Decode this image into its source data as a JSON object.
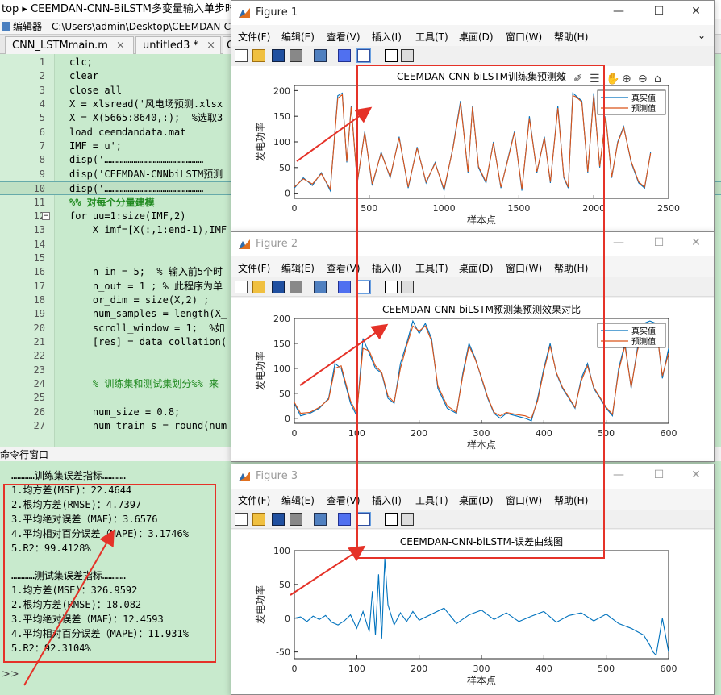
{
  "app": {
    "breadcrumb": "top ▸ CEEMDAN-CNN-BiLSTM多变量输入单步时间",
    "editor_path": "编辑器 - C:\\Users\\admin\\Desktop\\CEEMDAN-C",
    "tabs": [
      {
        "label": "CNN_LSTMmain.m"
      },
      {
        "label": "untitled3 *"
      },
      {
        "label": "C"
      }
    ]
  },
  "code_lines": [
    {
      "n": "1",
      "text": "clc;"
    },
    {
      "n": "2",
      "text": "clear"
    },
    {
      "n": "3",
      "text": "close all"
    },
    {
      "n": "4",
      "text": "X = xlsread('风电场预测.xlsx"
    },
    {
      "n": "5",
      "text": "X = X(5665:8640,:);  %选取3"
    },
    {
      "n": "6",
      "text": "load ceemdandata.mat"
    },
    {
      "n": "7",
      "text": "IMF = u';"
    },
    {
      "n": "8",
      "text": "disp('……………………………………………"
    },
    {
      "n": "9",
      "text": "disp('CEEMDAN-CNNbiLSTM预测"
    },
    {
      "n": "10",
      "text": "disp('……………………………………………"
    },
    {
      "n": "11",
      "text": "%% 对每个分量建模"
    },
    {
      "n": "12",
      "text": "for uu=1:size(IMF,2)"
    },
    {
      "n": "13",
      "text": "    X_imf=[X(:,1:end-1),IMF"
    },
    {
      "n": "14",
      "text": ""
    },
    {
      "n": "15",
      "text": ""
    },
    {
      "n": "16",
      "text": "    n_in = 5;  % 输入前5个时"
    },
    {
      "n": "17",
      "text": "    n_out = 1 ; % 此程序为单"
    },
    {
      "n": "18",
      "text": "    or_dim = size(X,2) ;"
    },
    {
      "n": "19",
      "text": "    num_samples = length(X_"
    },
    {
      "n": "20",
      "text": "    scroll_window = 1;  %如"
    },
    {
      "n": "21",
      "text": "    [res] = data_collation("
    },
    {
      "n": "22",
      "text": ""
    },
    {
      "n": "23",
      "text": ""
    },
    {
      "n": "24",
      "text": "    % 训练集和测试集划分%% 来"
    },
    {
      "n": "25",
      "text": ""
    },
    {
      "n": "26",
      "text": "    num_size = 0.8;"
    },
    {
      "n": "27",
      "text": "    num_train_s = round(num_"
    }
  ],
  "command_window": {
    "title": "命令行窗口",
    "prompt": ">>",
    "train_header": "…………训练集误差指标…………",
    "train": [
      "1.均方差(MSE)：22.4644",
      "2.根均方差(RMSE)：4.7397",
      "3.平均绝对误差（MAE）：3.6576",
      "4.平均相对百分误差（MAPE）：3.1746%",
      "5.R2：99.4128%"
    ],
    "test_header": "…………测试集误差指标…………",
    "test": [
      "1.均方差(MSE)：326.9592",
      "2.根均方差(RMSE)：18.082",
      "3.平均绝对误差（MAE）：12.4593",
      "4.平均相对百分误差（MAPE）：11.931%",
      "5.R2：92.3104%"
    ]
  },
  "figure_menu": [
    "文件(F)",
    "编辑(E)",
    "查看(V)",
    "插入(I)",
    "工具(T)",
    "桌面(D)",
    "窗口(W)",
    "帮助(H)"
  ],
  "figures": [
    {
      "title": "Figure 1",
      "chart_title": "CEEMDAN-CNN-biLSTM训练集预测效"
    },
    {
      "title": "Figure 2",
      "chart_title": "CEEMDAN-CNN-biLSTM预测集预测效果对比"
    },
    {
      "title": "Figure 3",
      "chart_title": "CEEMDAN-CNN-biLSTM-误差曲线图"
    }
  ],
  "colors": {
    "actual": "#0072BD",
    "predicted": "#D95319",
    "annotation": "#E53228"
  },
  "chart_data": [
    {
      "type": "line",
      "title": "CEEMDAN-CNN-biLSTM训练集预测效",
      "xlabel": "样本点",
      "ylabel": "发电功率",
      "xlim": [
        0,
        2500
      ],
      "ylim": [
        -10,
        210
      ],
      "xticks": [
        0,
        500,
        1000,
        1500,
        2000,
        2500
      ],
      "yticks": [
        0,
        50,
        100,
        150,
        200
      ],
      "legend": "top-right",
      "series": [
        {
          "name": "真实值",
          "x": [
            0,
            60,
            120,
            180,
            240,
            290,
            320,
            350,
            380,
            420,
            470,
            520,
            580,
            640,
            700,
            760,
            820,
            880,
            940,
            1000,
            1060,
            1110,
            1160,
            1190,
            1230,
            1280,
            1330,
            1380,
            1420,
            1470,
            1520,
            1570,
            1620,
            1670,
            1710,
            1760,
            1800,
            1830,
            1860,
            1880,
            1920,
            1960,
            2000,
            2040,
            2080,
            2120,
            2160,
            2200,
            2250,
            2300,
            2340,
            2380
          ],
          "values": [
            10,
            30,
            15,
            40,
            5,
            190,
            195,
            60,
            170,
            20,
            120,
            15,
            80,
            30,
            110,
            10,
            90,
            20,
            60,
            5,
            90,
            180,
            40,
            170,
            50,
            20,
            100,
            10,
            60,
            120,
            5,
            150,
            40,
            110,
            20,
            170,
            30,
            10,
            195,
            190,
            180,
            40,
            195,
            50,
            150,
            30,
            100,
            130,
            60,
            20,
            10,
            80
          ]
        },
        {
          "name": "预测值",
          "x": [
            0,
            60,
            120,
            180,
            240,
            290,
            320,
            350,
            380,
            420,
            470,
            520,
            580,
            640,
            700,
            760,
            820,
            880,
            940,
            1000,
            1060,
            1110,
            1160,
            1190,
            1230,
            1280,
            1330,
            1380,
            1420,
            1470,
            1520,
            1570,
            1620,
            1670,
            1710,
            1760,
            1800,
            1830,
            1860,
            1880,
            1920,
            1960,
            2000,
            2040,
            2080,
            2120,
            2160,
            2200,
            2250,
            2300,
            2340,
            2380
          ],
          "values": [
            12,
            28,
            18,
            38,
            8,
            185,
            192,
            62,
            168,
            22,
            118,
            18,
            78,
            32,
            108,
            12,
            88,
            22,
            58,
            8,
            88,
            176,
            42,
            168,
            52,
            22,
            98,
            12,
            58,
            118,
            8,
            146,
            42,
            108,
            22,
            166,
            32,
            12,
            190,
            188,
            178,
            42,
            190,
            52,
            148,
            32,
            98,
            128,
            62,
            22,
            12,
            78
          ]
        }
      ]
    },
    {
      "type": "line",
      "title": "CEEMDAN-CNN-biLSTM预测集预测效果对比",
      "xlabel": "样本点",
      "ylabel": "发电功率",
      "xlim": [
        0,
        600
      ],
      "ylim": [
        -10,
        200
      ],
      "xticks": [
        0,
        100,
        200,
        300,
        400,
        500,
        600
      ],
      "yticks": [
        0,
        50,
        100,
        150,
        200
      ],
      "legend": "top-right",
      "series": [
        {
          "name": "真实值",
          "x": [
            0,
            10,
            25,
            40,
            55,
            65,
            75,
            90,
            100,
            110,
            120,
            130,
            140,
            150,
            160,
            170,
            180,
            190,
            200,
            210,
            220,
            230,
            245,
            260,
            270,
            280,
            290,
            300,
            310,
            320,
            330,
            340,
            355,
            370,
            380,
            390,
            400,
            410,
            420,
            430,
            440,
            450,
            460,
            470,
            480,
            490,
            500,
            510,
            520,
            530,
            540,
            550,
            560,
            570,
            580,
            590,
            600
          ],
          "values": [
            30,
            5,
            10,
            20,
            40,
            110,
            100,
            30,
            5,
            160,
            130,
            100,
            90,
            40,
            30,
            110,
            150,
            195,
            170,
            190,
            160,
            60,
            20,
            10,
            90,
            150,
            120,
            80,
            40,
            10,
            0,
            10,
            5,
            0,
            -5,
            40,
            100,
            150,
            90,
            60,
            40,
            20,
            80,
            110,
            60,
            40,
            20,
            5,
            100,
            150,
            60,
            140,
            190,
            195,
            190,
            80,
            140
          ]
        },
        {
          "name": "预测值",
          "x": [
            0,
            10,
            25,
            40,
            55,
            65,
            75,
            90,
            100,
            110,
            120,
            130,
            140,
            150,
            160,
            170,
            180,
            190,
            200,
            210,
            220,
            230,
            245,
            260,
            270,
            280,
            290,
            300,
            310,
            320,
            330,
            340,
            355,
            370,
            380,
            390,
            400,
            410,
            420,
            430,
            440,
            450,
            460,
            470,
            480,
            490,
            500,
            510,
            520,
            530,
            540,
            550,
            560,
            570,
            580,
            590,
            600
          ],
          "values": [
            32,
            10,
            12,
            22,
            38,
            100,
            105,
            35,
            10,
            140,
            135,
            105,
            92,
            45,
            32,
            100,
            145,
            185,
            175,
            185,
            155,
            65,
            25,
            12,
            85,
            145,
            118,
            82,
            42,
            12,
            5,
            12,
            8,
            5,
            0,
            35,
            95,
            145,
            92,
            62,
            42,
            22,
            75,
            105,
            62,
            42,
            22,
            8,
            95,
            145,
            62,
            135,
            180,
            185,
            185,
            85,
            130
          ]
        }
      ]
    },
    {
      "type": "line",
      "title": "CEEMDAN-CNN-biLSTM-误差曲线图",
      "xlabel": "样本点",
      "ylabel": "发电功率",
      "xlim": [
        0,
        600
      ],
      "ylim": [
        -60,
        100
      ],
      "xticks": [
        0,
        100,
        200,
        300,
        400,
        500,
        600
      ],
      "yticks": [
        -50,
        0,
        50,
        100
      ],
      "legend": "none",
      "series": [
        {
          "x": [
            0,
            10,
            20,
            30,
            40,
            50,
            60,
            70,
            80,
            90,
            100,
            110,
            120,
            125,
            130,
            135,
            140,
            145,
            150,
            160,
            170,
            180,
            190,
            200,
            220,
            240,
            260,
            280,
            300,
            320,
            340,
            360,
            380,
            400,
            420,
            440,
            460,
            480,
            500,
            520,
            540,
            550,
            560,
            570,
            575,
            580,
            590,
            600
          ],
          "values": [
            0,
            2,
            -5,
            3,
            -2,
            4,
            -6,
            -10,
            -4,
            5,
            -15,
            10,
            -20,
            40,
            -25,
            65,
            -30,
            88,
            20,
            -10,
            8,
            -5,
            10,
            -3,
            6,
            15,
            -8,
            5,
            12,
            -2,
            8,
            -5,
            3,
            10,
            -6,
            4,
            8,
            -4,
            6,
            -8,
            -15,
            -20,
            -25,
            -40,
            -50,
            -55,
            0,
            -50
          ]
        }
      ]
    }
  ]
}
